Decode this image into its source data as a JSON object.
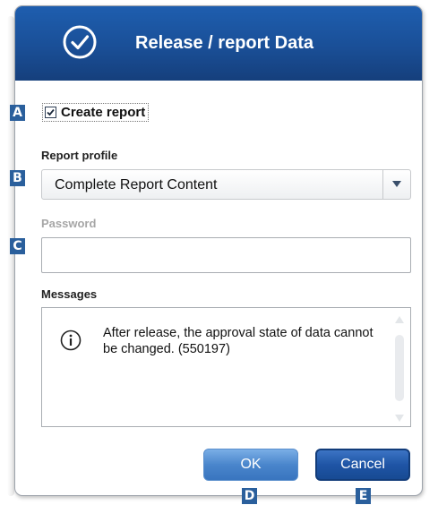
{
  "dialog": {
    "title": "Release / report Data",
    "create_report": {
      "label": "Create report",
      "checked": true
    },
    "report_profile": {
      "label": "Report profile",
      "selected": "Complete Report Content"
    },
    "password": {
      "label": "Password",
      "value": ""
    },
    "messages": {
      "label": "Messages",
      "items": [
        "After release, the approval state of data cannot be changed. (550197)"
      ]
    },
    "buttons": {
      "ok": "OK",
      "cancel": "Cancel"
    }
  },
  "markers": [
    "A",
    "B",
    "C",
    "D",
    "E"
  ],
  "icons": {
    "title": "checkmark-circle-icon",
    "message": "info-icon",
    "dropdown": "chevron-down-icon"
  },
  "colors": {
    "titlebar": "#1a4f97",
    "marker": "#2a5f9c",
    "ok_button": "#4a86cc",
    "cancel_button": "#1f55a6"
  }
}
